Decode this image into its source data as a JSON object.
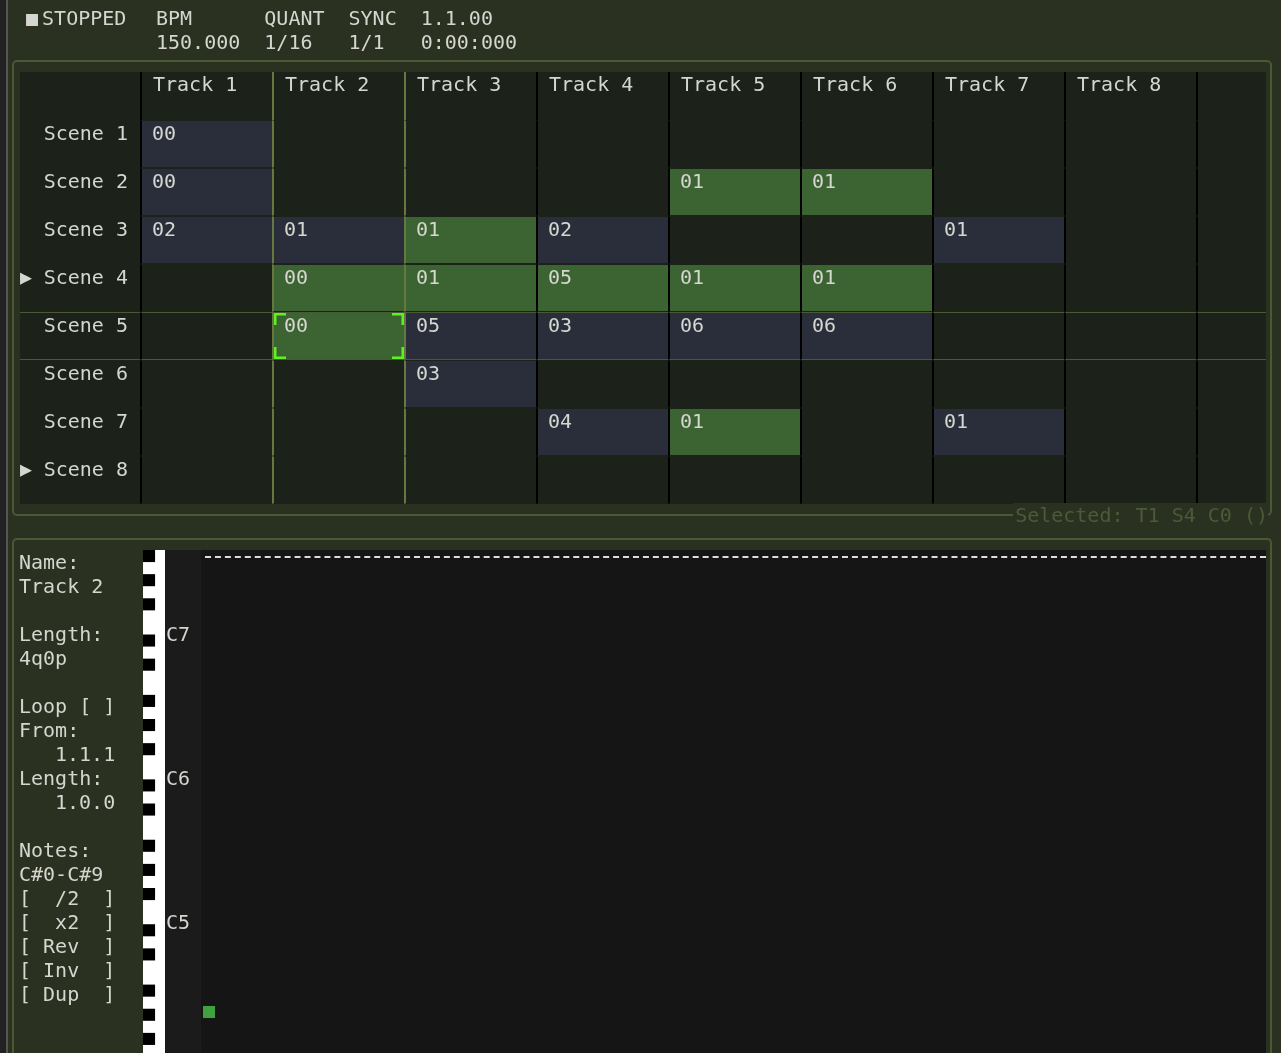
{
  "transport": {
    "status_icon": "■",
    "status": "STOPPED",
    "fields": [
      {
        "label": "BPM",
        "value": "150.000"
      },
      {
        "label": "QUANT",
        "value": "1/16"
      },
      {
        "label": "SYNC",
        "value": "1/1"
      },
      {
        "label": "1.1.00",
        "value": "0:00:000"
      }
    ]
  },
  "session": {
    "tracks": [
      {
        "name": "Track 1"
      },
      {
        "name": "Track 2"
      },
      {
        "name": "Track 3"
      },
      {
        "name": "Track 4"
      },
      {
        "name": "Track 5"
      },
      {
        "name": "Track 6"
      },
      {
        "name": "Track 7"
      },
      {
        "name": "Track 8"
      }
    ],
    "scenes": [
      {
        "name": "Scene 1",
        "playing": false,
        "selected": false,
        "cells": [
          {
            "kind": "stopped",
            "text": "00"
          },
          {
            "kind": "empty"
          },
          {
            "kind": "empty"
          },
          {
            "kind": "empty"
          },
          {
            "kind": "empty"
          },
          {
            "kind": "empty"
          },
          {
            "kind": "empty"
          },
          {
            "kind": "empty"
          }
        ]
      },
      {
        "name": "Scene 2",
        "playing": false,
        "selected": false,
        "cells": [
          {
            "kind": "stopped",
            "text": "00"
          },
          {
            "kind": "empty"
          },
          {
            "kind": "empty"
          },
          {
            "kind": "empty"
          },
          {
            "kind": "playing",
            "text": "01"
          },
          {
            "kind": "playing",
            "text": "01"
          },
          {
            "kind": "empty"
          },
          {
            "kind": "empty"
          }
        ]
      },
      {
        "name": "Scene 3",
        "playing": false,
        "selected": false,
        "cells": [
          {
            "kind": "stopped",
            "text": "02"
          },
          {
            "kind": "stopped",
            "text": "01"
          },
          {
            "kind": "playing",
            "text": "01"
          },
          {
            "kind": "stopped",
            "text": "02"
          },
          {
            "kind": "empty"
          },
          {
            "kind": "empty"
          },
          {
            "kind": "stopped",
            "text": "01"
          },
          {
            "kind": "empty"
          }
        ]
      },
      {
        "name": "Scene 4",
        "playing": true,
        "selected": false,
        "cells": [
          {
            "kind": "empty"
          },
          {
            "kind": "playing",
            "text": "00"
          },
          {
            "kind": "playing",
            "text": "01"
          },
          {
            "kind": "playing",
            "text": "05"
          },
          {
            "kind": "playing",
            "text": "01"
          },
          {
            "kind": "playing",
            "text": "01"
          },
          {
            "kind": "empty"
          },
          {
            "kind": "empty"
          }
        ]
      },
      {
        "name": "Scene 5",
        "playing": false,
        "selected": true,
        "cells": [
          {
            "kind": "empty"
          },
          {
            "kind": "playing",
            "text": "00",
            "selected": true
          },
          {
            "kind": "stopped",
            "text": "05"
          },
          {
            "kind": "stopped",
            "text": "03"
          },
          {
            "kind": "stopped",
            "text": "06"
          },
          {
            "kind": "stopped",
            "text": "06"
          },
          {
            "kind": "empty"
          },
          {
            "kind": "empty"
          }
        ]
      },
      {
        "name": "Scene 6",
        "playing": false,
        "selected": false,
        "cells": [
          {
            "kind": "empty"
          },
          {
            "kind": "empty"
          },
          {
            "kind": "stopped",
            "text": "03"
          },
          {
            "kind": "empty"
          },
          {
            "kind": "empty"
          },
          {
            "kind": "empty"
          },
          {
            "kind": "empty"
          },
          {
            "kind": "empty"
          }
        ]
      },
      {
        "name": "Scene 7",
        "playing": false,
        "selected": false,
        "cells": [
          {
            "kind": "empty"
          },
          {
            "kind": "empty"
          },
          {
            "kind": "empty"
          },
          {
            "kind": "stopped",
            "text": "04"
          },
          {
            "kind": "playing",
            "text": "01"
          },
          {
            "kind": "empty"
          },
          {
            "kind": "stopped",
            "text": "01"
          },
          {
            "kind": "empty"
          }
        ]
      },
      {
        "name": "Scene 8",
        "playing": true,
        "selected": false,
        "cells": [
          {
            "kind": "empty"
          },
          {
            "kind": "empty"
          },
          {
            "kind": "empty"
          },
          {
            "kind": "empty"
          },
          {
            "kind": "empty"
          },
          {
            "kind": "empty"
          },
          {
            "kind": "empty"
          },
          {
            "kind": "empty"
          }
        ]
      }
    ],
    "play_marker": "▶",
    "selection_status": "Selected: T1 S4 C0 ()"
  },
  "clip_editor": {
    "sections": [
      [
        {
          "kind": "label",
          "text": "Name:"
        },
        {
          "kind": "value",
          "text": "Track 2"
        }
      ],
      [
        {
          "kind": "label",
          "text": "Length:"
        },
        {
          "kind": "value",
          "text": "4q0p"
        }
      ],
      [
        {
          "kind": "button",
          "text": "Loop [ ]"
        },
        {
          "kind": "label",
          "text": "From:"
        },
        {
          "kind": "indented",
          "text": "1.1.1"
        },
        {
          "kind": "label",
          "text": "Length:"
        },
        {
          "kind": "indented",
          "text": "1.0.0"
        }
      ],
      [
        {
          "kind": "label",
          "text": "Notes:"
        },
        {
          "kind": "value",
          "text": "C#0-C#9"
        },
        {
          "kind": "button",
          "text": "[  /2  ]"
        },
        {
          "kind": "button",
          "text": "[  x2  ]"
        },
        {
          "kind": "button",
          "text": "[ Rev  ]"
        },
        {
          "kind": "button",
          "text": "[ Inv  ]"
        },
        {
          "kind": "button",
          "text": "[ Dup  ]"
        }
      ]
    ],
    "octave_labels": [
      "C7",
      "C6",
      "C5"
    ]
  }
}
